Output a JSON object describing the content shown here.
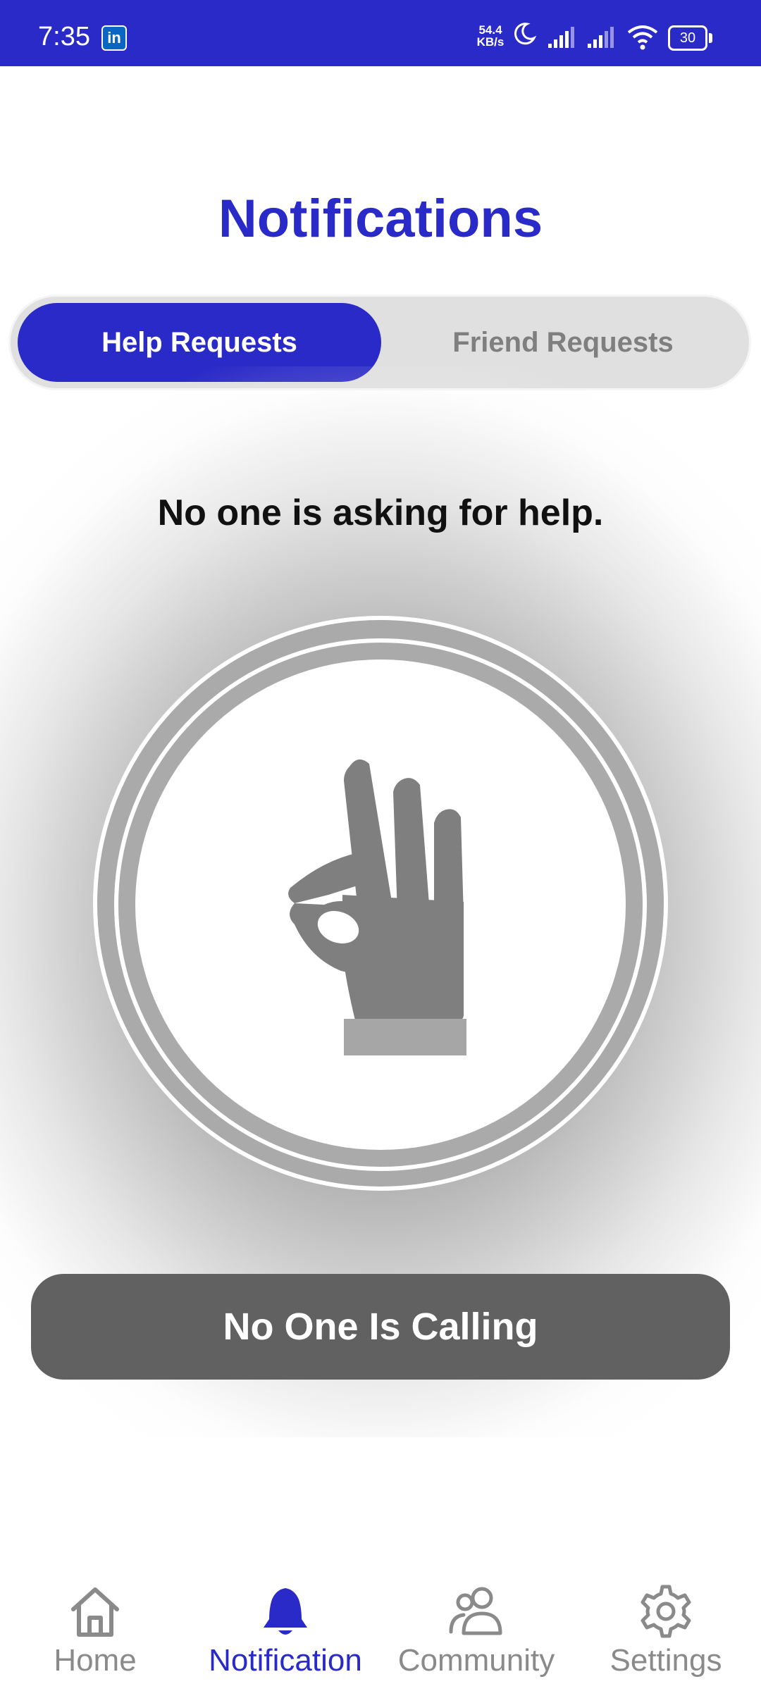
{
  "status_bar": {
    "time": "7:35",
    "notification_app": "in",
    "net_speed_value": "54.4",
    "net_speed_unit": "KB/s",
    "battery_level": "30",
    "icons": [
      "linkedin-icon",
      "moon-icon",
      "signal-icon",
      "signal-icon",
      "wifi-icon",
      "battery-icon"
    ]
  },
  "header": {
    "title": "Notifications"
  },
  "tabs": [
    {
      "label": "Help Requests",
      "active": true
    },
    {
      "label": "Friend Requests",
      "active": false
    }
  ],
  "empty_state": {
    "message": "No one is asking for help.",
    "icon": "ok-hand-icon"
  },
  "call_button": {
    "label": "No One Is Calling"
  },
  "bottom_nav": [
    {
      "label": "Home",
      "icon": "home-icon",
      "active": false
    },
    {
      "label": "Notification",
      "icon": "bell-icon",
      "active": true
    },
    {
      "label": "Community",
      "icon": "people-icon",
      "active": false
    },
    {
      "label": "Settings",
      "icon": "gear-icon",
      "active": false
    }
  ],
  "colors": {
    "primary": "#2a2ac8",
    "status_bar": "#2a2ac8",
    "inactive_tab_text": "#7f7f7f",
    "button_bg": "#616161",
    "nav_inactive": "#8a8a8a"
  }
}
